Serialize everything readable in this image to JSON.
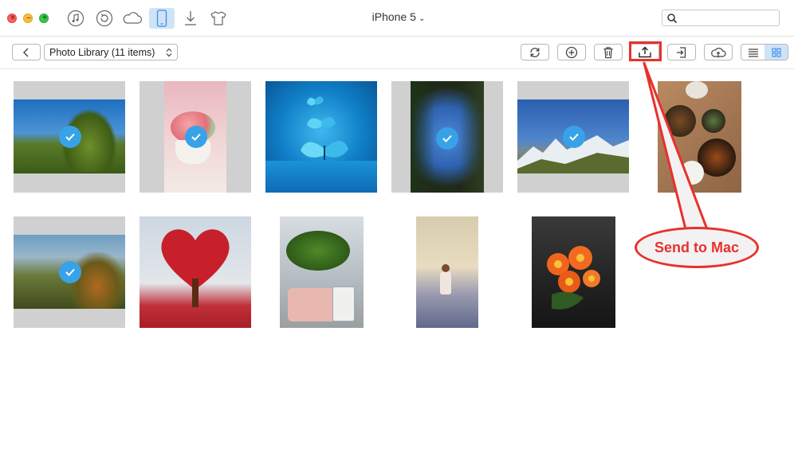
{
  "window": {
    "title": "iPhone 5",
    "title_chevron": "⌄"
  },
  "titlebar_icons": [
    "music-note-icon",
    "restore-icon",
    "cloud-icon",
    "iphone-icon",
    "download-icon",
    "tshirt-icon"
  ],
  "search": {
    "placeholder": ""
  },
  "toolbar": {
    "library_label": "Photo Library (11 items)",
    "buttons": [
      "refresh-icon",
      "add-icon",
      "trash-icon",
      "send-to-mac-icon",
      "send-to-device-icon",
      "upload-cloud-icon"
    ],
    "view_modes": [
      "list",
      "grid"
    ],
    "active_view": "grid"
  },
  "photos": [
    {
      "subject": "forest-sky",
      "selected": true
    },
    {
      "subject": "cupcake",
      "selected": true
    },
    {
      "subject": "blue-butterflies",
      "selected": false
    },
    {
      "subject": "trees-looking-up",
      "selected": true
    },
    {
      "subject": "snowy-mountains",
      "selected": true
    },
    {
      "subject": "food-table",
      "selected": false
    },
    {
      "subject": "autumn-hills",
      "selected": true
    },
    {
      "subject": "heart-tree",
      "selected": false
    },
    {
      "subject": "office-desk-plant",
      "selected": false
    },
    {
      "subject": "girl-in-field",
      "selected": false
    },
    {
      "subject": "orange-flowers",
      "selected": false
    }
  ],
  "callout": {
    "text": "Send to Mac",
    "color": "#e8312c"
  },
  "colors": {
    "accent": "#38a2e8",
    "active_bg": "#cfe3f7"
  }
}
